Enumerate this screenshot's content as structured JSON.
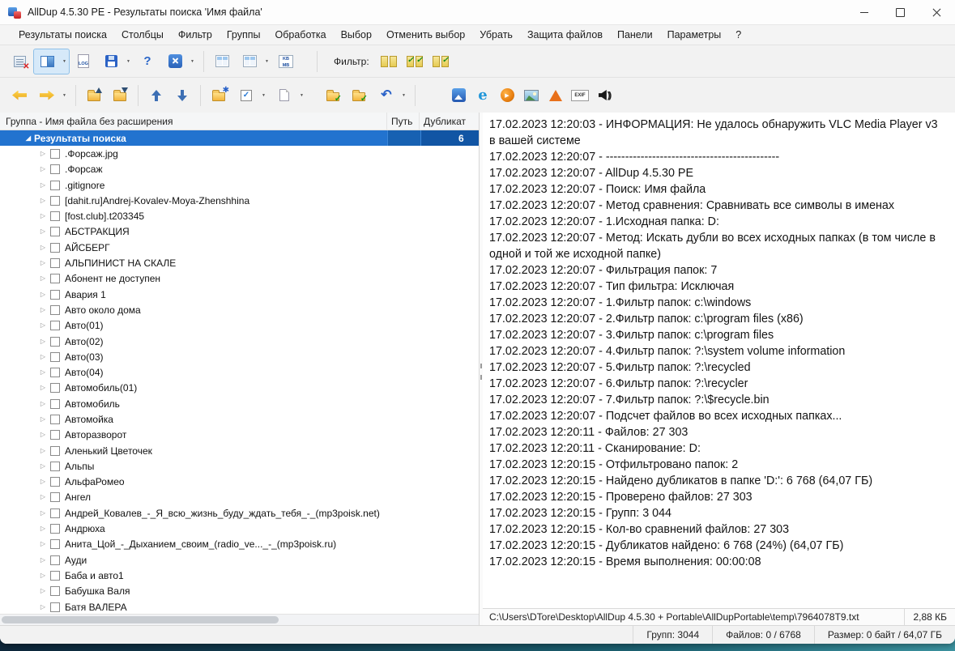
{
  "window": {
    "title": "AllDup 4.5.30 PE - Результаты поиска 'Имя файла'"
  },
  "menu": {
    "items": [
      "Результаты поиска",
      "Столбцы",
      "Фильтр",
      "Группы",
      "Обработка",
      "Выбор",
      "Отменить выбор",
      "Убрать",
      "Защита файлов",
      "Панели",
      "Параметры",
      "?"
    ]
  },
  "toolbar": {
    "log_label": "LOG",
    "kb_label": "KB",
    "mb_label": "MB",
    "help_label": "?",
    "filter_label": "Фильтр:",
    "exif_label": "EXIF"
  },
  "tree": {
    "columns": {
      "name": "Группа - Имя файла без расширения",
      "path": "Путь",
      "duplicate": "Дубликат"
    },
    "root": {
      "label": "Результаты поиска",
      "duplicates": "6"
    },
    "items": [
      ".Форсаж.jpg",
      ".Форсаж",
      ".gitignore",
      "[dahit.ru]Andrej-Kovalev-Moya-Zhenshhina",
      "[fost.club].t203345",
      "АБСТРАКЦИЯ",
      "АЙСБЕРГ",
      "АЛЬПИНИСТ НА СКАЛЕ",
      "Абонент не доступен",
      "Авария 1",
      "Авто около дома",
      "Авто(01)",
      "Авто(02)",
      "Авто(03)",
      "Авто(04)",
      "Автомобиль(01)",
      "Автомобиль",
      "Автомойка",
      "Авторазворот",
      "Аленький Цветочек",
      "Альпы",
      "АльфаРомео",
      "Ангел",
      "Андрей_Ковалев_-_Я_всю_жизнь_буду_ждать_тебя_-_(mp3poisk.net)",
      "Андрюха",
      "Анита_Цой_-_Дыханием_своим_(radio_ve..._-_(mp3poisk.ru)",
      "Ауди",
      "Баба и авто1",
      "Бабушка Валя",
      "Батя ВАЛЕРА"
    ]
  },
  "log": {
    "lines": [
      "17.02.2023 12:20:03 - ИНФОРМАЦИЯ: Не удалось обнаружить VLC Media Player v3 в вашей системе",
      "17.02.2023 12:20:07 - ---------------------------------------------",
      "17.02.2023 12:20:07 - AllDup 4.5.30 PE",
      "17.02.2023 12:20:07 - Поиск: Имя файла",
      "17.02.2023 12:20:07 - Метод сравнения: Сравнивать все символы в именах",
      "17.02.2023 12:20:07 - 1.Исходная папка: D:",
      "17.02.2023 12:20:07 - Метод: Искать дубли во всех исходных папках (в том числе в одной и той же исходной папке)",
      "17.02.2023 12:20:07 - Фильтрация папок: 7",
      "17.02.2023 12:20:07 - Тип фильтра: Исключая",
      "17.02.2023 12:20:07 - 1.Фильтр папок: c:\\windows",
      "17.02.2023 12:20:07 - 2.Фильтр папок: c:\\program files (x86)",
      "17.02.2023 12:20:07 - 3.Фильтр папок: c:\\program files",
      "17.02.2023 12:20:07 - 4.Фильтр папок: ?:\\system volume information",
      "17.02.2023 12:20:07 - 5.Фильтр папок: ?:\\recycled",
      "17.02.2023 12:20:07 - 6.Фильтр папок: ?:\\recycler",
      "17.02.2023 12:20:07 - 7.Фильтр папок: ?:\\$recycle.bin",
      "17.02.2023 12:20:07 - Подсчет файлов во всех исходных папках...",
      "17.02.2023 12:20:11 - Файлов: 27 303",
      "17.02.2023 12:20:11 - Сканирование: D:",
      "17.02.2023 12:20:15 - Отфильтровано папок: 2",
      "17.02.2023 12:20:15 - Найдено дубликатов в папке 'D:': 6 768 (64,07 ГБ)",
      "17.02.2023 12:20:15 - Проверено файлов: 27 303",
      "17.02.2023 12:20:15 - Групп: 3 044",
      "17.02.2023 12:20:15 - Кол-во сравнений файлов: 27 303",
      "17.02.2023 12:20:15 - Дубликатов найдено: 6 768 (24%) (64,07 ГБ)",
      "17.02.2023 12:20:15 - Время выполнения: 00:00:08"
    ]
  },
  "file_status": {
    "path": "C:\\Users\\DTore\\Desktop\\AllDup 4.5.30 + Portable\\AllDupPortable\\temp\\7964078T9.txt",
    "size": "2,88 КБ"
  },
  "status_bar": {
    "groups": "Групп: 3044",
    "files": "Файлов: 0 / 6768",
    "size": "Размер: 0 байт / 64,07 ГБ"
  }
}
